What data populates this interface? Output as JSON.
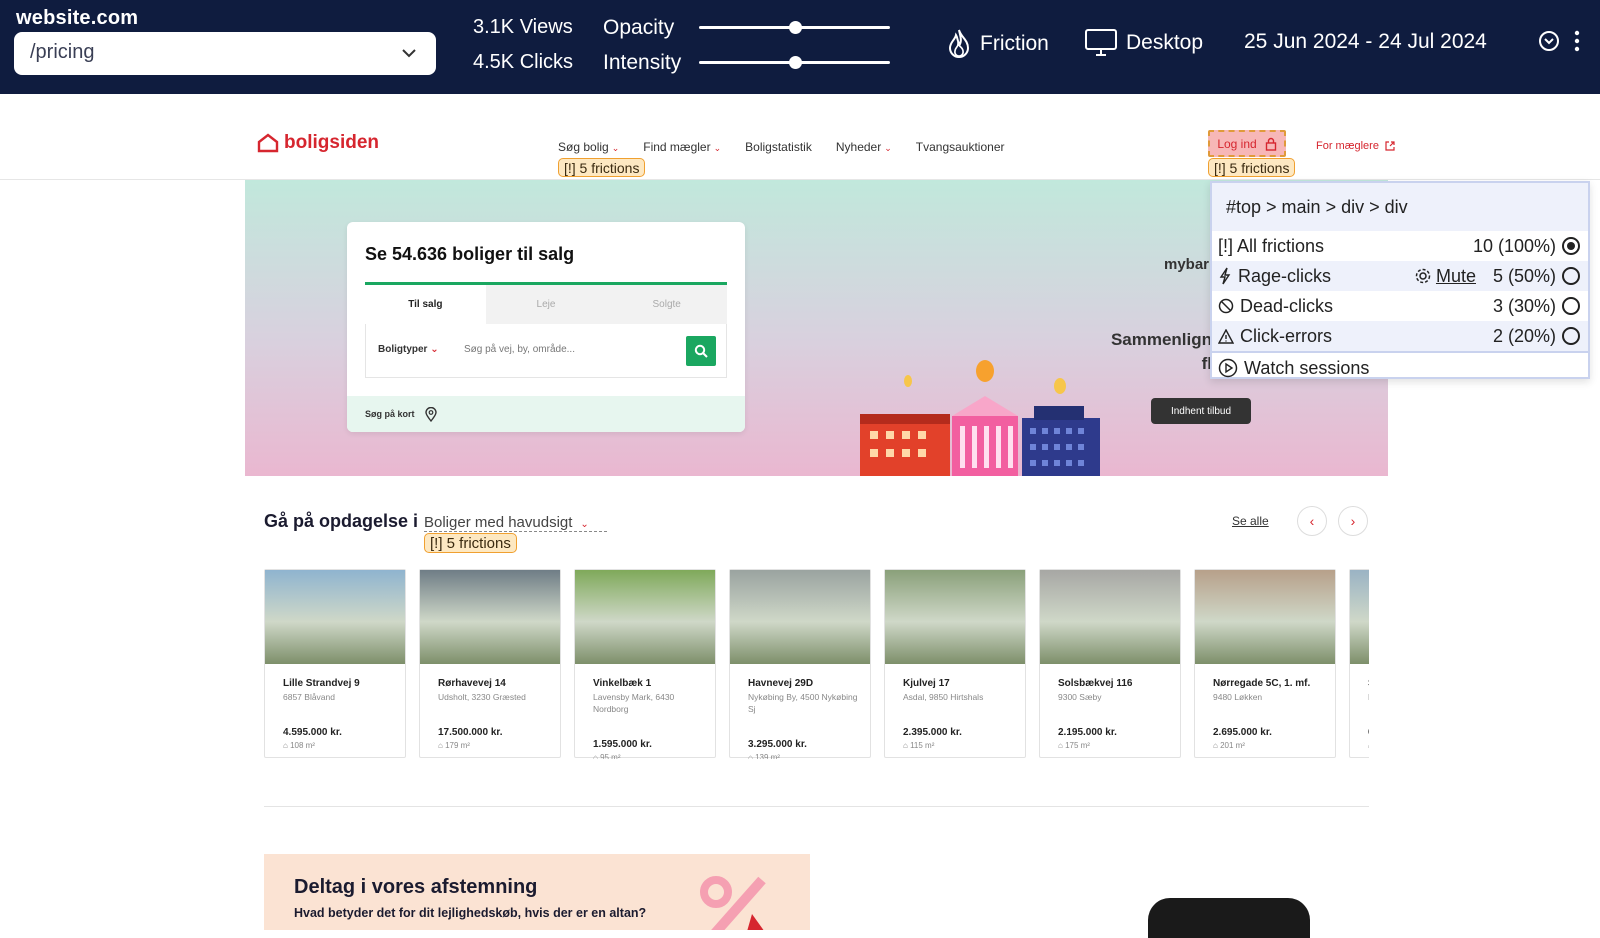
{
  "analytics": {
    "site": "website.com",
    "url": "/pricing",
    "views": "3.1K Views",
    "clicks": "4.5K Clicks",
    "opacity_label": "Opacity",
    "intensity_label": "Intensity",
    "opacity_value": 0.5,
    "intensity_value": 0.5,
    "mode": "Friction",
    "device": "Desktop",
    "date_range": "25 Jun 2024 - 24 Jul 2024"
  },
  "site": {
    "logo": "boligsiden",
    "nav": [
      {
        "label": "Søg bolig",
        "caret": true
      },
      {
        "label": "Find mægler",
        "caret": true
      },
      {
        "label": "Boligstatistik",
        "caret": false
      },
      {
        "label": "Nyheder",
        "caret": true
      },
      {
        "label": "Tvangsauktioner",
        "caret": false
      }
    ],
    "login": "Log ind",
    "for_brokers": "For mæglere",
    "friction_tag": "[!] 5 frictions"
  },
  "hero": {
    "title": "Se 54.636 boliger til salg",
    "tabs": [
      "Til salg",
      "Leje",
      "Solgte"
    ],
    "type_select": "Boligtyper",
    "search_placeholder": "Søg på vej, by, område...",
    "map_search": "Søg på kort",
    "bank": "mybar",
    "compare_line1": "Sammenlign tilbud",
    "compare_line2": "flere bo",
    "offer_button": "Indhent tilbud"
  },
  "popover": {
    "path": "#top > main > div > div",
    "rows": [
      {
        "label": "[!] All frictions",
        "value": "10 (100%)",
        "selected": true
      },
      {
        "label": "Rage-clicks",
        "value": "5 (50%)",
        "selected": false,
        "mute": "Mute"
      },
      {
        "label": "Dead-clicks",
        "value": "3 (30%)",
        "selected": false
      },
      {
        "label": "Click-errors",
        "value": "2 (20%)",
        "selected": false
      }
    ],
    "watch": "Watch sessions"
  },
  "explore": {
    "title": "Gå på opdagelse i",
    "select": "Boliger med havudsigt",
    "see_all": "Se alle",
    "listings": [
      {
        "address": "Lille Strandvej 9",
        "sub": "6857 Blåvand",
        "price": "4.595.000 kr.",
        "area": "108 m²",
        "color": "#8fb4cf"
      },
      {
        "address": "Rørhavevej 14",
        "sub": "Udsholt, 3230 Græsted",
        "price": "17.500.000 kr.",
        "area": "179 m²",
        "color": "#6f7d86"
      },
      {
        "address": "Vinkelbæk 1",
        "sub": "Lavensby Mark, 6430 Nordborg",
        "price": "1.595.000 kr.",
        "area": "95 m²",
        "color": "#7fa95a"
      },
      {
        "address": "Havnevej 29D",
        "sub": "Nykøbing By, 4500 Nykøbing Sj",
        "price": "3.295.000 kr.",
        "area": "139 m²",
        "color": "#9aa3a0"
      },
      {
        "address": "Kjulvej 17",
        "sub": "Asdal, 9850 Hirtshals",
        "price": "2.395.000 kr.",
        "area": "115 m²",
        "color": "#8aa07a"
      },
      {
        "address": "Solsbækvej 116",
        "sub": "9300 Sæby",
        "price": "2.195.000 kr.",
        "area": "175 m²",
        "color": "#a7a7a4"
      },
      {
        "address": "Nørregade 5C, 1. mf.",
        "sub": "9480 Løkken",
        "price": "2.695.000 kr.",
        "area": "201 m²",
        "color": "#b7a08a"
      },
      {
        "address": "S",
        "sub": "B",
        "price": "6",
        "area": "",
        "color": "#9ab3c4"
      }
    ]
  },
  "survey": {
    "title": "Deltag i vores afstemning",
    "question": "Hvad betyder det for dit lejlighedskøb, hvis der er en altan?"
  }
}
